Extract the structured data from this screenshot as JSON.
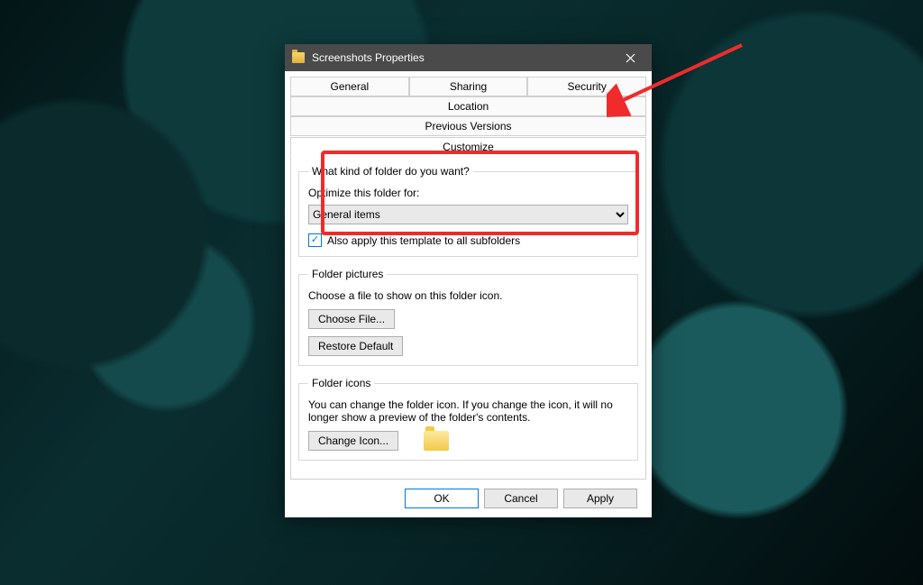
{
  "window": {
    "title": "Screenshots Properties"
  },
  "tabs": {
    "general": "General",
    "sharing": "Sharing",
    "security": "Security",
    "location": "Location",
    "previous": "Previous Versions",
    "customize": "Customize"
  },
  "customize": {
    "group_kind": {
      "legend": "What kind of folder do you want?",
      "optimize_label": "Optimize this folder for:",
      "optimize_value": "General items",
      "apply_sub": "Also apply this template to all subfolders"
    },
    "group_pictures": {
      "legend": "Folder pictures",
      "desc": "Choose a file to show on this folder icon.",
      "choose_file": "Choose File...",
      "restore_default": "Restore Default"
    },
    "group_icons": {
      "legend": "Folder icons",
      "desc": "You can change the folder icon. If you change the icon, it will no longer show a preview of the folder's contents.",
      "change_icon": "Change Icon..."
    }
  },
  "buttons": {
    "ok": "OK",
    "cancel": "Cancel",
    "apply": "Apply"
  }
}
